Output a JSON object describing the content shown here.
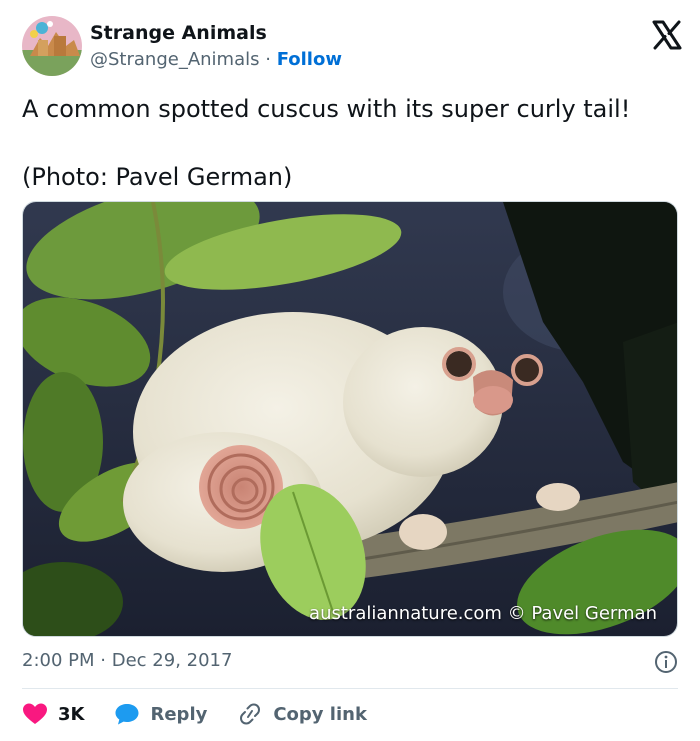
{
  "author": {
    "name": "Strange Animals",
    "handle": "@Strange_Animals",
    "separator": "·",
    "follow_label": "Follow"
  },
  "tweet": {
    "text": "A common spotted cuscus with its super curly tail!\n\n(Photo: Pavel German)",
    "image_watermark": "australiannature.com © Pavel German"
  },
  "meta": {
    "time": "2:00 PM",
    "separator": "·",
    "date": "Dec 29, 2017"
  },
  "actions": {
    "likes_count": "3K",
    "reply_label": "Reply",
    "copy_link_label": "Copy link"
  },
  "colors": {
    "like_heart": "#f91880",
    "reply_bubble": "#1d9bf0",
    "follow_link": "#006fd6",
    "muted_text": "#536471"
  },
  "icons": {
    "brand": "x-logo-icon",
    "info": "info-icon",
    "like": "heart-icon",
    "reply": "speech-bubble-icon",
    "copy": "link-icon"
  }
}
